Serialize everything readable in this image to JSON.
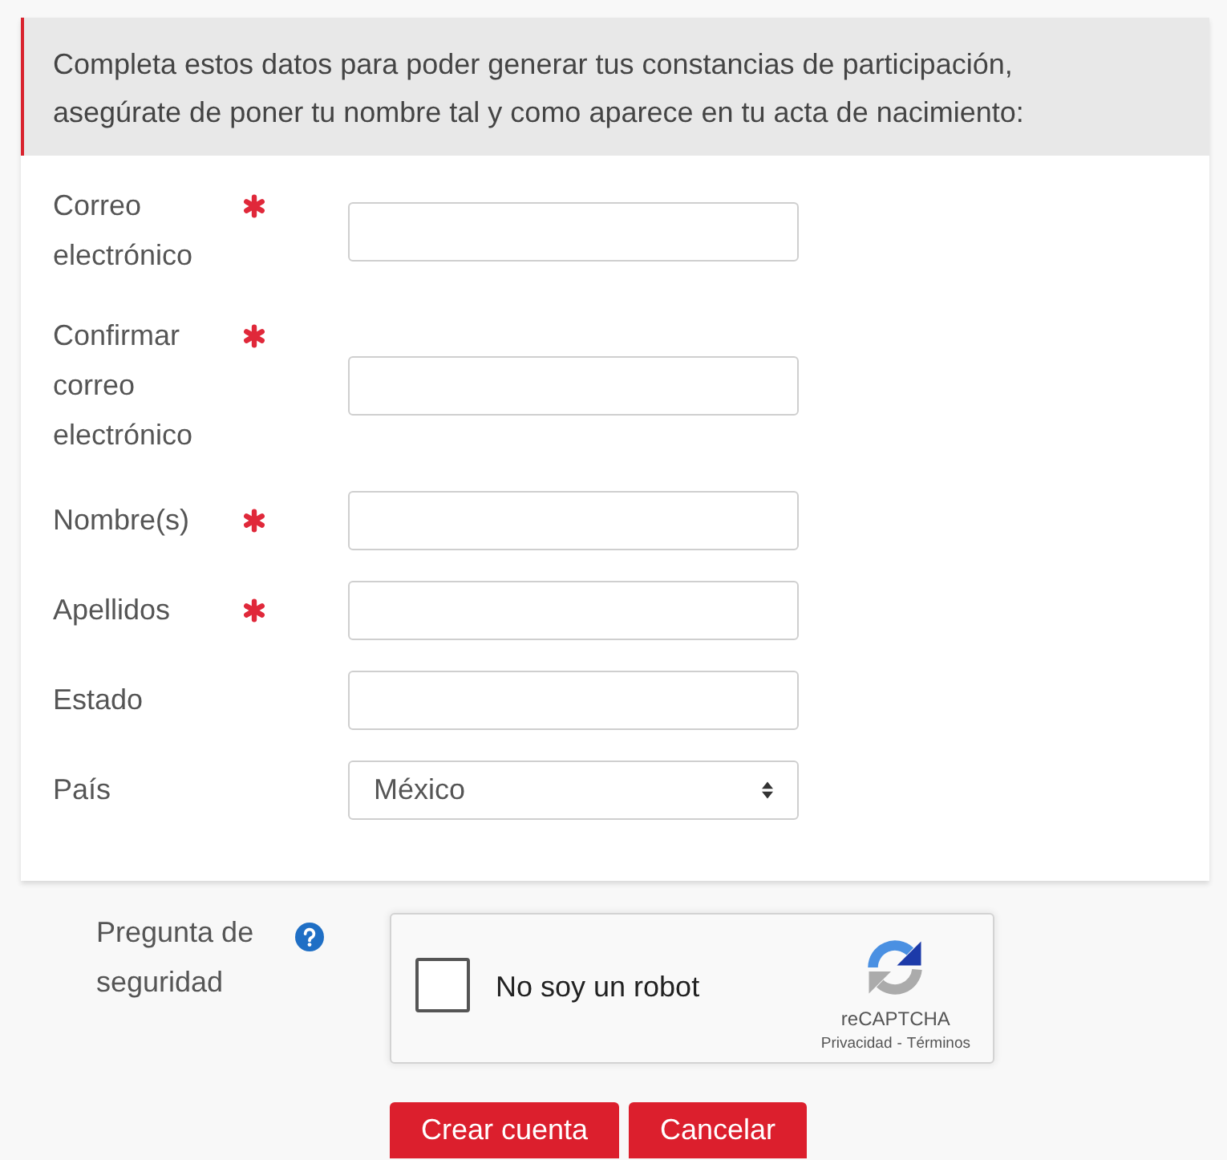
{
  "notice": {
    "text": "Completa estos datos para poder generar tus constancias de participación, asegúrate de poner tu nombre tal y como aparece en tu acta de nacimiento:"
  },
  "fields": [
    {
      "label": "Correo electrónico",
      "required": true,
      "kind": "text"
    },
    {
      "label": "Confirmar correo electrónico",
      "required": true,
      "kind": "text"
    },
    {
      "label": "Nombre(s)",
      "required": true,
      "kind": "text"
    },
    {
      "label": "Apellidos",
      "required": true,
      "kind": "text"
    },
    {
      "label": "Estado",
      "required": false,
      "kind": "text"
    },
    {
      "label": "País",
      "required": false,
      "kind": "select",
      "value": "México"
    }
  ],
  "security": {
    "label": "Pregunta de seguridad",
    "captcha": {
      "checked": false,
      "label": "No soy un robot",
      "brand": "reCAPTCHA",
      "links": [
        "Privacidad",
        "Términos"
      ],
      "separator": "-"
    }
  },
  "buttons": [
    "Crear cuenta",
    "Cancelar"
  ]
}
